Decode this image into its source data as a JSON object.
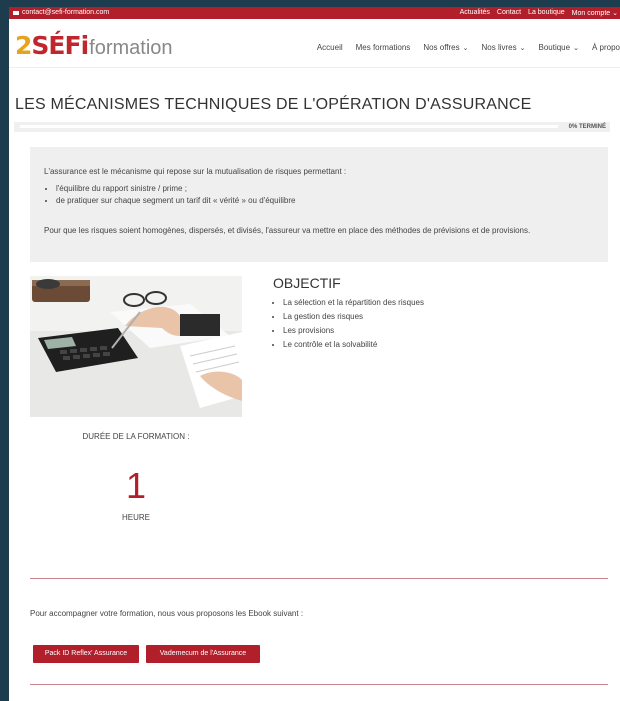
{
  "topbar": {
    "email": "contact@sefi-formation.com",
    "links": [
      "Actualités",
      "Contact",
      "La boutique",
      "Mon compte"
    ]
  },
  "logo": {
    "mark_a": "2",
    "mark_b": "SÉ",
    "mark_c": "Fi",
    "word": "formation"
  },
  "nav": [
    {
      "label": "Accueil",
      "dropdown": false
    },
    {
      "label": "Mes formations",
      "dropdown": false
    },
    {
      "label": "Nos offres",
      "dropdown": true
    },
    {
      "label": "Nos livres",
      "dropdown": true
    },
    {
      "label": "Boutique",
      "dropdown": true
    },
    {
      "label": "À propos",
      "dropdown": false
    }
  ],
  "page_title": "LES MÉCANISMES TECHNIQUES DE L'OPÉRATION D'ASSURANCE",
  "progress": {
    "percent": 0,
    "label": "0% TERMINÉ"
  },
  "intro": {
    "p1": "L'assurance est le mécanisme qui repose sur la mutualisation de risques permettant :",
    "bullets": [
      "l'équilibre du rapport sinistre / prime ;",
      "de pratiquer sur chaque segment un tarif dit « vérité » ou d'équilibre"
    ],
    "p2": "Pour que les risques soient homogènes, dispersés, et divisés, l'assureur va mettre en place des méthodes de prévisions et de provisions."
  },
  "objectif": {
    "title": "OBJECTIF",
    "items": [
      "La sélection et la répartition des risques",
      "La gestion des risques",
      "Les provisions",
      "Le contrôle et la solvabilité"
    ]
  },
  "duration": {
    "label": "DURÉE DE LA FORMATION :",
    "value": "1",
    "unit": "HEURE"
  },
  "ebook": {
    "text": "Pour accompagner votre formation, nous vous proposons les Ebook suivant :",
    "buttons": [
      "Pack ID Reflex' Assurance",
      "Vademecum de l'Assurance"
    ]
  },
  "colors": {
    "brand_red": "#b01f2a",
    "brand_orange": "#e7a21e",
    "frame": "#1d3c4e"
  }
}
